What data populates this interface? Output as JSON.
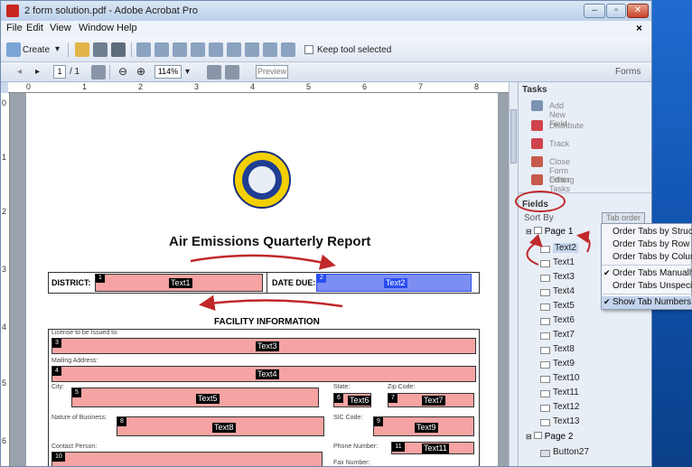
{
  "window": {
    "title": "2 form solution.pdf - Adobe Acrobat Pro"
  },
  "menu": [
    "File",
    "Edit",
    "View",
    "Window",
    "Help"
  ],
  "toolbar": {
    "create_label": "Create",
    "keep_tool_label": "Keep tool selected"
  },
  "nav": {
    "page_current": "1",
    "page_total": "/ 1",
    "zoom": "114%",
    "preview_label": "Preview",
    "forms_label": "Forms"
  },
  "rulers": {
    "top": [
      "0",
      "1",
      "2",
      "3",
      "4",
      "5",
      "6",
      "7",
      "8"
    ],
    "left": [
      "0",
      "1",
      "2",
      "3",
      "4",
      "5",
      "6"
    ]
  },
  "document": {
    "title": "Air Emissions Quarterly Report",
    "district_label": "DISTRICT:",
    "date_due_label": "DATE DUE:",
    "facility_header": "FACILITY INFORMATION",
    "license_label": "License to be Issued to:",
    "mailing_label": "Mailing Address:",
    "city_label": "City:",
    "state_label": "State:",
    "zip_label": "Zip Code:",
    "business_label": "Nature of Business:",
    "sic_label": "SIC Code:",
    "contact_label": "Contact Person:",
    "phone_label": "Phone Number:",
    "fax_label": "Fax Number:",
    "fields": [
      {
        "num": "1",
        "name": "Text1"
      },
      {
        "num": "2",
        "name": "Text2"
      },
      {
        "num": "3",
        "name": "Text3"
      },
      {
        "num": "4",
        "name": "Text4"
      },
      {
        "num": "5",
        "name": "Text5"
      },
      {
        "num": "6",
        "name": "Text6"
      },
      {
        "num": "7",
        "name": "Text7"
      },
      {
        "num": "8",
        "name": "Text8"
      },
      {
        "num": "9",
        "name": "Text9"
      },
      {
        "num": "10",
        "name": "Text10"
      },
      {
        "num": "11",
        "name": "Text11"
      }
    ]
  },
  "panel": {
    "tasks_title": "Tasks",
    "tasks": [
      "Add New Field",
      "Distribute",
      "Track",
      "Close Form Editing",
      "Other Tasks"
    ],
    "fields_title": "Fields",
    "sort_label": "Sort By",
    "tab_order_label": "Tab order",
    "page1": "Page 1",
    "page2": "Page 2",
    "field_list": [
      "Text2",
      "Text1",
      "Text3",
      "Text4",
      "Text5",
      "Text6",
      "Text7",
      "Text8",
      "Text9",
      "Text10",
      "Text11",
      "Text12",
      "Text13"
    ],
    "button_field": "Button27"
  },
  "context_menu": [
    {
      "label": "Order Tabs by Structure",
      "checked": false
    },
    {
      "label": "Order Tabs by Row",
      "checked": false
    },
    {
      "label": "Order Tabs by Column",
      "checked": false
    },
    {
      "label": "Order Tabs Manually",
      "checked": true
    },
    {
      "label": "Order Tabs Unspecified",
      "checked": false
    },
    {
      "label": "Show Tab Numbers",
      "checked": true
    }
  ],
  "colors": {
    "field_fill": "#f6a3a3",
    "annotation_red": "#c0282a",
    "selection_blue": "#2a4df0",
    "seal_gold": "#f3d000"
  }
}
